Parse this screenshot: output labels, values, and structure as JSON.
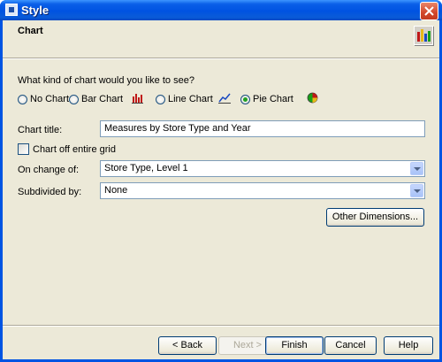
{
  "window": {
    "title": "Style"
  },
  "header": {
    "title": "Chart"
  },
  "question": "What kind of chart would you like to see?",
  "chart_options": {
    "no_chart": "No Chart",
    "bar_chart": "Bar Chart",
    "line_chart": "Line Chart",
    "pie_chart": "Pie Chart",
    "selected": "Pie Chart"
  },
  "chart_title": {
    "label": "Chart title:",
    "value": "Measures by Store Type and Year"
  },
  "chart_off_grid": {
    "label": "Chart off entire grid",
    "checked": false
  },
  "on_change_of": {
    "label": "On change of:",
    "value": "Store Type, Level 1"
  },
  "subdivided_by": {
    "label": "Subdivided by:",
    "value": "None"
  },
  "buttons": {
    "other_dimensions": "Other Dimensions...",
    "back": "< Back",
    "next": "Next >",
    "finish": "Finish",
    "cancel": "Cancel",
    "help": "Help"
  },
  "icons": {
    "app": "dialog-icon",
    "header": "chart-wizard-icon",
    "bar": "bar-chart-icon",
    "line": "line-chart-icon",
    "pie": "pie-chart-icon",
    "close": "close-icon"
  },
  "colors": {
    "titlebar": "#0054e3",
    "dialog_bg": "#ece9d8",
    "radio_selected": "#21a121"
  }
}
